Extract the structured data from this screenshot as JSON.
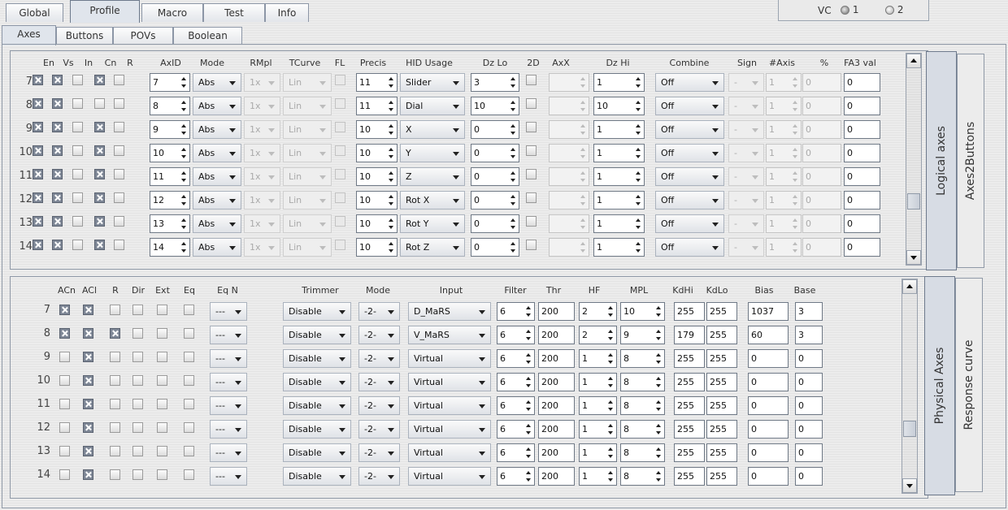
{
  "main_tabs": [
    {
      "label": "Global",
      "selected": false
    },
    {
      "label": "Profile",
      "selected": true
    },
    {
      "label": "Macro",
      "selected": false
    },
    {
      "label": "Test",
      "selected": false
    },
    {
      "label": "Info",
      "selected": false
    }
  ],
  "sub_tabs": [
    {
      "label": "Axes",
      "selected": true
    },
    {
      "label": "Buttons",
      "selected": false
    },
    {
      "label": "POVs",
      "selected": false
    },
    {
      "label": "Boolean",
      "selected": false
    }
  ],
  "vc": {
    "label": "VC",
    "options": [
      "1",
      "2"
    ],
    "selected": "1"
  },
  "logical": {
    "headers": [
      "En",
      "Vs",
      "In",
      "Cn",
      "R",
      "AxID",
      "Mode",
      "RMpl",
      "TCurve",
      "FL",
      "Precis",
      "HID Usage",
      "Dz Lo",
      "2D",
      "AxX",
      "Dz Hi",
      "Combine",
      "Sign",
      "#Axis",
      "%",
      "FA3 val"
    ],
    "rows": [
      {
        "num": "7",
        "en": true,
        "vs": true,
        "in": false,
        "cn": true,
        "r": false,
        "axid": "7",
        "mode": "Abs",
        "rmpl": "1x",
        "tcurve": "Lin",
        "precis": "11",
        "hid": "Slider",
        "dzlo": "3",
        "axx": "",
        "dzhi": "1",
        "combine": "Off",
        "sign": "-",
        "naxis": "1",
        "pct": "0",
        "fa3": "0"
      },
      {
        "num": "8",
        "en": true,
        "vs": true,
        "in": false,
        "cn": false,
        "r": false,
        "axid": "8",
        "mode": "Abs",
        "rmpl": "1x",
        "tcurve": "Lin",
        "precis": "11",
        "hid": "Dial",
        "dzlo": "10",
        "axx": "",
        "dzhi": "10",
        "combine": "Off",
        "sign": "-",
        "naxis": "1",
        "pct": "0",
        "fa3": "0"
      },
      {
        "num": "9",
        "en": true,
        "vs": true,
        "in": false,
        "cn": true,
        "r": false,
        "axid": "9",
        "mode": "Abs",
        "rmpl": "1x",
        "tcurve": "Lin",
        "precis": "10",
        "hid": "X",
        "dzlo": "0",
        "axx": "",
        "dzhi": "1",
        "combine": "Off",
        "sign": "-",
        "naxis": "1",
        "pct": "0",
        "fa3": "0"
      },
      {
        "num": "10",
        "en": true,
        "vs": true,
        "in": false,
        "cn": true,
        "r": false,
        "axid": "10",
        "mode": "Abs",
        "rmpl": "1x",
        "tcurve": "Lin",
        "precis": "10",
        "hid": "Y",
        "dzlo": "0",
        "axx": "",
        "dzhi": "1",
        "combine": "Off",
        "sign": "-",
        "naxis": "1",
        "pct": "0",
        "fa3": "0"
      },
      {
        "num": "11",
        "en": true,
        "vs": true,
        "in": false,
        "cn": true,
        "r": false,
        "axid": "11",
        "mode": "Abs",
        "rmpl": "1x",
        "tcurve": "Lin",
        "precis": "10",
        "hid": "Z",
        "dzlo": "0",
        "axx": "",
        "dzhi": "1",
        "combine": "Off",
        "sign": "-",
        "naxis": "1",
        "pct": "0",
        "fa3": "0"
      },
      {
        "num": "12",
        "en": true,
        "vs": true,
        "in": false,
        "cn": true,
        "r": false,
        "axid": "12",
        "mode": "Abs",
        "rmpl": "1x",
        "tcurve": "Lin",
        "precis": "10",
        "hid": "Rot X",
        "dzlo": "0",
        "axx": "",
        "dzhi": "1",
        "combine": "Off",
        "sign": "-",
        "naxis": "1",
        "pct": "0",
        "fa3": "0"
      },
      {
        "num": "13",
        "en": true,
        "vs": true,
        "in": false,
        "cn": true,
        "r": false,
        "axid": "13",
        "mode": "Abs",
        "rmpl": "1x",
        "tcurve": "Lin",
        "precis": "10",
        "hid": "Rot Y",
        "dzlo": "0",
        "axx": "",
        "dzhi": "1",
        "combine": "Off",
        "sign": "-",
        "naxis": "1",
        "pct": "0",
        "fa3": "0"
      },
      {
        "num": "14",
        "en": true,
        "vs": true,
        "in": false,
        "cn": true,
        "r": false,
        "axid": "14",
        "mode": "Abs",
        "rmpl": "1x",
        "tcurve": "Lin",
        "precis": "10",
        "hid": "Rot Z",
        "dzlo": "0",
        "axx": "",
        "dzhi": "1",
        "combine": "Off",
        "sign": "-",
        "naxis": "1",
        "pct": "0",
        "fa3": "0"
      }
    ],
    "side_tabs": [
      {
        "label": "Logical axes",
        "selected": true
      },
      {
        "label": "Axes2Buttons",
        "selected": false
      }
    ]
  },
  "physical": {
    "headers": [
      "ACn",
      "ACl",
      "R",
      "Dir",
      "Ext",
      "Eq",
      "Eq N",
      "Trimmer",
      "Mode",
      "Input",
      "Filter",
      "Thr",
      "HF",
      "MPL",
      "KdHi",
      "KdLo",
      "Bias",
      "Base"
    ],
    "rows": [
      {
        "num": "7",
        "acn": true,
        "acl": true,
        "r": false,
        "dir": false,
        "ext": false,
        "eq": false,
        "eqn": "---",
        "trimmer": "Disable",
        "mode": "-2-",
        "input": "D_MaRS",
        "filter": "6",
        "thr": "200",
        "hf": "2",
        "mpl": "10",
        "kdhi": "255",
        "kdlo": "255",
        "bias": "1037",
        "base": "3"
      },
      {
        "num": "8",
        "acn": true,
        "acl": true,
        "r": true,
        "dir": false,
        "ext": false,
        "eq": false,
        "eqn": "---",
        "trimmer": "Disable",
        "mode": "-2-",
        "input": "V_MaRS",
        "filter": "6",
        "thr": "200",
        "hf": "2",
        "mpl": "9",
        "kdhi": "179",
        "kdlo": "255",
        "bias": "60",
        "base": "3"
      },
      {
        "num": "9",
        "acn": false,
        "acl": true,
        "r": false,
        "dir": false,
        "ext": false,
        "eq": false,
        "eqn": "---",
        "trimmer": "Disable",
        "mode": "-2-",
        "input": "Virtual",
        "filter": "6",
        "thr": "200",
        "hf": "1",
        "mpl": "8",
        "kdhi": "255",
        "kdlo": "255",
        "bias": "0",
        "base": "0"
      },
      {
        "num": "10",
        "acn": false,
        "acl": true,
        "r": false,
        "dir": false,
        "ext": false,
        "eq": false,
        "eqn": "---",
        "trimmer": "Disable",
        "mode": "-2-",
        "input": "Virtual",
        "filter": "6",
        "thr": "200",
        "hf": "1",
        "mpl": "8",
        "kdhi": "255",
        "kdlo": "255",
        "bias": "0",
        "base": "0"
      },
      {
        "num": "11",
        "acn": false,
        "acl": true,
        "r": false,
        "dir": false,
        "ext": false,
        "eq": false,
        "eqn": "---",
        "trimmer": "Disable",
        "mode": "-2-",
        "input": "Virtual",
        "filter": "6",
        "thr": "200",
        "hf": "1",
        "mpl": "8",
        "kdhi": "255",
        "kdlo": "255",
        "bias": "0",
        "base": "0"
      },
      {
        "num": "12",
        "acn": false,
        "acl": true,
        "r": false,
        "dir": false,
        "ext": false,
        "eq": false,
        "eqn": "---",
        "trimmer": "Disable",
        "mode": "-2-",
        "input": "Virtual",
        "filter": "6",
        "thr": "200",
        "hf": "1",
        "mpl": "8",
        "kdhi": "255",
        "kdlo": "255",
        "bias": "0",
        "base": "0"
      },
      {
        "num": "13",
        "acn": false,
        "acl": true,
        "r": false,
        "dir": false,
        "ext": false,
        "eq": false,
        "eqn": "---",
        "trimmer": "Disable",
        "mode": "-2-",
        "input": "Virtual",
        "filter": "6",
        "thr": "200",
        "hf": "1",
        "mpl": "8",
        "kdhi": "255",
        "kdlo": "255",
        "bias": "0",
        "base": "0"
      },
      {
        "num": "14",
        "acn": false,
        "acl": true,
        "r": false,
        "dir": false,
        "ext": false,
        "eq": false,
        "eqn": "---",
        "trimmer": "Disable",
        "mode": "-2-",
        "input": "Virtual",
        "filter": "6",
        "thr": "200",
        "hf": "1",
        "mpl": "8",
        "kdhi": "255",
        "kdlo": "255",
        "bias": "0",
        "base": "0"
      }
    ],
    "side_tabs": [
      {
        "label": "Physical Axes",
        "selected": true
      },
      {
        "label": "Response curve",
        "selected": false
      }
    ]
  }
}
